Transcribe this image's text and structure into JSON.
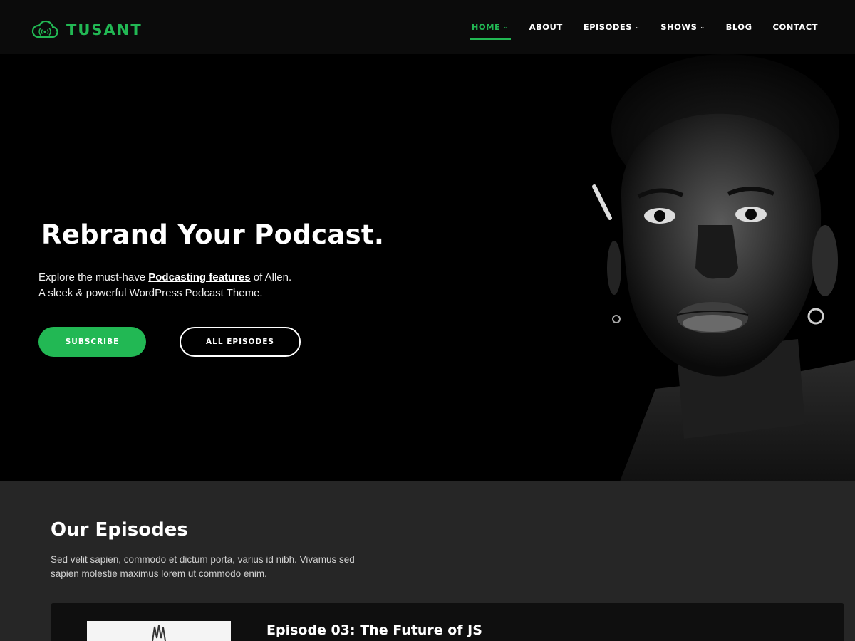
{
  "brand": {
    "name": "TUSANT",
    "accent": "#22b854",
    "icon": "cloud-podcast-icon"
  },
  "nav": {
    "items": [
      {
        "label": "HOME",
        "dropdown": true,
        "active": true
      },
      {
        "label": "ABOUT",
        "dropdown": false
      },
      {
        "label": "EPISODES",
        "dropdown": true
      },
      {
        "label": "SHOWS",
        "dropdown": true
      },
      {
        "label": "BLOG",
        "dropdown": false
      },
      {
        "label": "CONTACT",
        "dropdown": false
      }
    ],
    "chevron": "⌄"
  },
  "hero": {
    "title": "Rebrand Your Podcast.",
    "desc_pre": "Explore the must-have ",
    "desc_link": "Podcasting features",
    "desc_post": " of Allen.",
    "desc_line2": "A sleek & powerful WordPress Podcast Theme.",
    "subscribe_label": "SUBSCRIBE",
    "all_episodes_label": "ALL EPISODES"
  },
  "episodes": {
    "title": "Our Episodes",
    "description": "Sed velit sapien, commodo et dictum porta, varius id nibh. Vivamus sed sapien molestie maximus lorem ut commodo enim.",
    "items": [
      {
        "title": "Episode 03: The Future of JS"
      }
    ]
  }
}
